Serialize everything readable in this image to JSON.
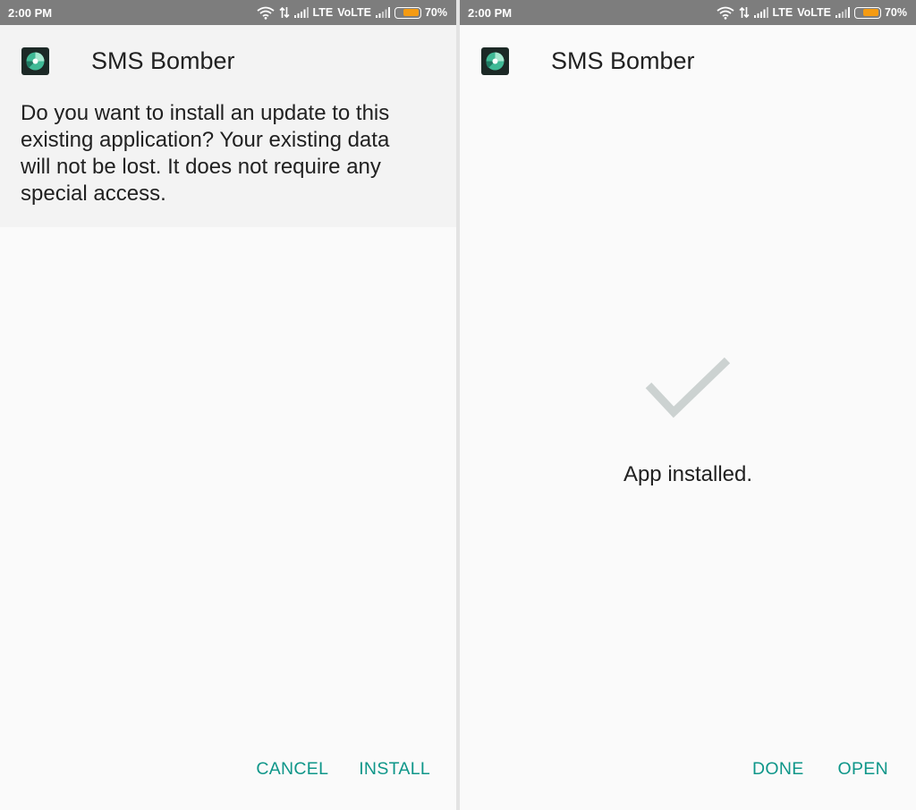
{
  "status_bar": {
    "time": "2:00 PM",
    "network_1": "LTE",
    "network_2": "VoLTE",
    "battery_level": 0.7,
    "battery_text": "70%",
    "icons": [
      "wifi-icon",
      "data-transfer-icon",
      "signal-icon",
      "signal-icon",
      "battery-icon"
    ]
  },
  "install_prompt": {
    "app_name": "SMS Bomber",
    "message": "Do you want to install an update to this existing application? Your existing data will not be lost. It does not require any special access.",
    "cancel_label": "CANCEL",
    "install_label": "INSTALL"
  },
  "install_result": {
    "app_name": "SMS Bomber",
    "message": "App installed.",
    "done_label": "DONE",
    "open_label": "OPEN"
  },
  "colors": {
    "status_bar": "#7d7d7d",
    "accent": "#0e9689",
    "battery": "#f59b12",
    "check": "#ccd2d1"
  }
}
